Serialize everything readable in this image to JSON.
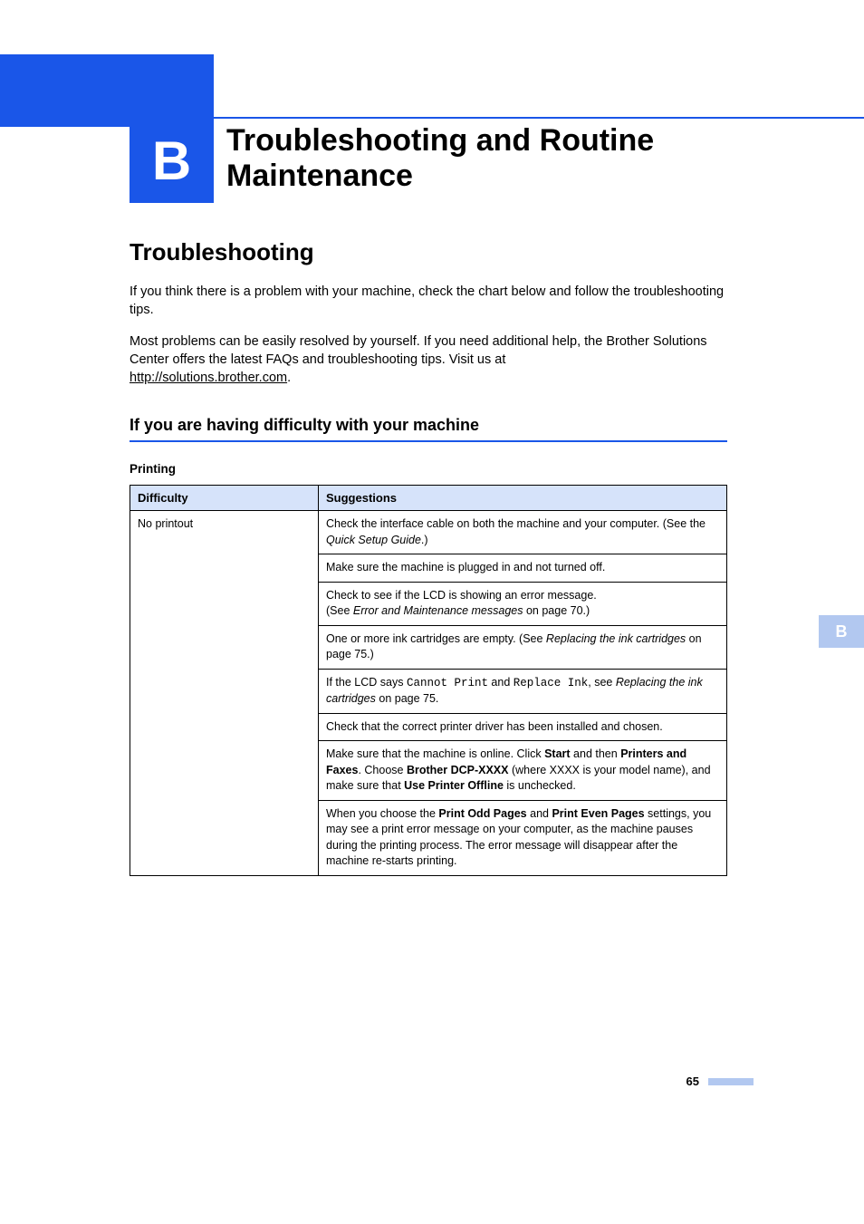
{
  "chapter": {
    "letter": "B",
    "title": "Troubleshooting and Routine Maintenance"
  },
  "section": {
    "title": "Troubleshooting",
    "para1": "If you think there is a problem with your machine, check the chart below and follow the troubleshooting tips.",
    "para2a": "Most problems can be easily resolved by yourself. If you need additional help, the Brother Solutions Center offers the latest FAQs and troubleshooting tips. Visit us at ",
    "link": "http://solutions.brother.com",
    "para2b": "."
  },
  "subsection": {
    "title": "If you are having difficulty with your machine"
  },
  "table": {
    "label": "Printing",
    "headers": {
      "difficulty": "Difficulty",
      "suggestions": "Suggestions"
    },
    "row_difficulty": "No printout",
    "s1a": "Check the interface cable on both the machine and your computer. (See the ",
    "s1b": "Quick Setup Guide",
    "s1c": ".)",
    "s2": "Make sure the machine is plugged in and not turned off.",
    "s3a": "Check to see if the LCD is showing an error message.",
    "s3b": "(See ",
    "s3c": "Error and Maintenance messages",
    "s3d": " on page 70.)",
    "s4a": "One or more ink cartridges are empty. (See ",
    "s4b": "Replacing the ink cartridges",
    "s4c": " on page 75.)",
    "s5a": "If the LCD says ",
    "s5b": "Cannot Print",
    "s5c": " and ",
    "s5d": "Replace Ink",
    "s5e": ", see ",
    "s5f": "Replacing the ink cartridges",
    "s5g": " on page 75.",
    "s6": "Check that the correct printer driver has been installed and chosen.",
    "s7a": "Make sure that the machine is online. Click ",
    "s7b": "Start",
    "s7c": " and then ",
    "s7d": "Printers and Faxes",
    "s7e": ". Choose ",
    "s7f": "Brother DCP-XXXX",
    "s7g": " (where XXXX is your model name), and make sure that ",
    "s7h": "Use Printer Offline",
    "s7i": " is unchecked.",
    "s8a": "When you choose the ",
    "s8b": "Print Odd Pages",
    "s8c": " and ",
    "s8d": "Print Even Pages",
    "s8e": " settings, you may see a print error message on your computer, as the machine pauses during the printing process. The error message will disappear after the machine re-starts printing."
  },
  "sidebar": {
    "letter": "B"
  },
  "footer": {
    "page": "65"
  }
}
